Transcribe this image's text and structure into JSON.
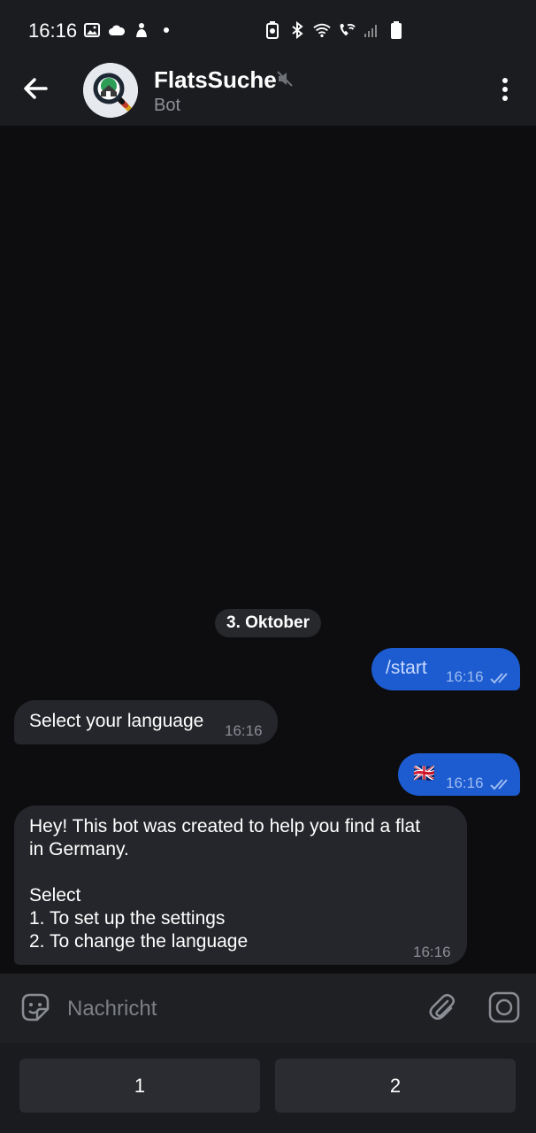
{
  "status_bar": {
    "time": "16:16",
    "left_icons": [
      "image-icon",
      "cloud-icon",
      "app-icon",
      "dot-icon"
    ],
    "right_icons": [
      "battery-saver-icon",
      "bluetooth-icon",
      "wifi-icon",
      "wifi-calling-icon",
      "signal-icon",
      "battery-icon"
    ]
  },
  "header": {
    "title": "FlatsSuche",
    "subtitle": "Bot",
    "muted": true
  },
  "messages": {
    "date_chip": "3. Oktober",
    "m1": {
      "direction": "out",
      "text": "/start",
      "time": "16:16",
      "read": true
    },
    "m2": {
      "direction": "in",
      "text": "Select your language",
      "time": "16:16"
    },
    "m3": {
      "direction": "out",
      "text": "🇬🇧",
      "time": "16:16",
      "read": true
    },
    "m4": {
      "direction": "in",
      "line1": "Hey! This bot was created to help you find a flat",
      "line2": "in Germany.",
      "line3": "Select",
      "line4": "1. To set up the settings",
      "line5": "2. To change the language",
      "time": "16:16"
    }
  },
  "composer": {
    "placeholder": "Nachricht"
  },
  "keyboard": {
    "buttons": [
      "1",
      "2"
    ]
  },
  "colors": {
    "background": "#0d0d10",
    "bar": "#1b1c20",
    "outgoing_bubble": "#1c5bd0",
    "incoming_bubble": "#25262b"
  }
}
